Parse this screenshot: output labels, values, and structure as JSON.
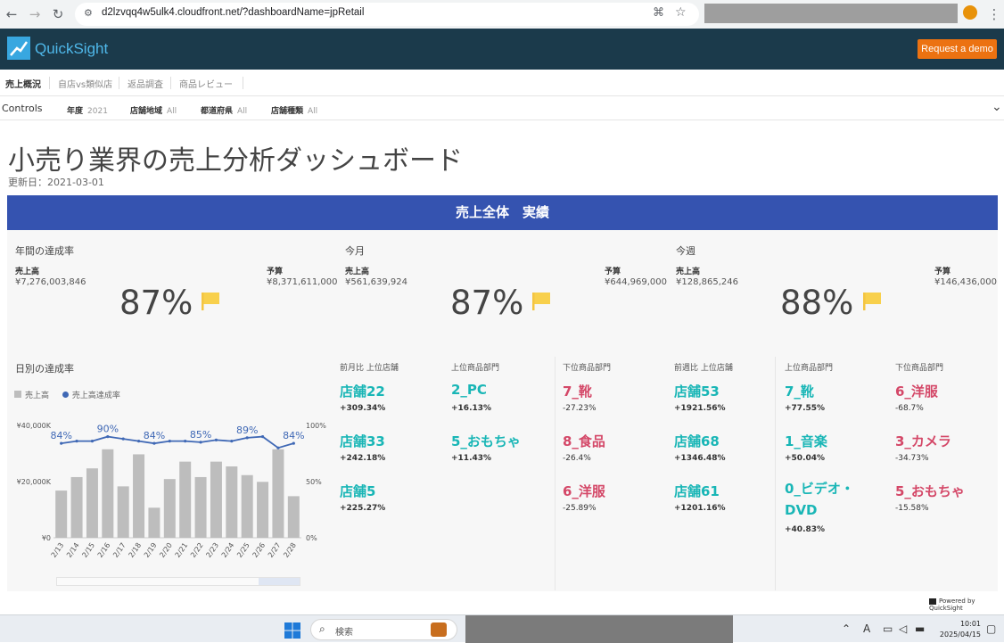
{
  "browser": {
    "url": "d2lzvqq4w5ulk4.cloudfront.net/?dashboardName=jpRetail"
  },
  "app": {
    "logo_text": "QuickSight",
    "demo_button": "Request a demo",
    "brand_color": "#1b3a4b",
    "accent_color": "#ec7211"
  },
  "tabs": [
    "売上概況",
    "自店vs類似店",
    "返品調査",
    "商品レビュー"
  ],
  "controls": {
    "title": "Controls",
    "items": [
      {
        "label": "年度",
        "value": "2021"
      },
      {
        "label": "店舗地域",
        "value": "All"
      },
      {
        "label": "都道府県",
        "value": "All"
      },
      {
        "label": "店舗種類",
        "value": "All"
      }
    ]
  },
  "dashboard": {
    "title": "小売り業界の売上分析ダッシュボード",
    "updated": "更新日：2021-03-01",
    "banner": "売上全体　実績"
  },
  "kpis": [
    {
      "title": "年間の達成率",
      "sales_label": "売上高",
      "sales": "¥7,276,003,846",
      "budget_label": "予算",
      "budget": "¥8,371,611,000",
      "pct": "87%"
    },
    {
      "title": "今月",
      "sales_label": "売上高",
      "sales": "¥561,639,924",
      "budget_label": "予算",
      "budget": "¥644,969,000",
      "pct": "87%"
    },
    {
      "title": "今週",
      "sales_label": "売上高",
      "sales": "¥128,865,246",
      "budget_label": "予算",
      "budget": "¥146,436,000",
      "pct": "88%"
    }
  ],
  "daily": {
    "title": "日別の達成率",
    "legend_sales": "売上高",
    "legend_rate": "売上高達成率"
  },
  "chart_data": {
    "type": "bar",
    "categories": [
      "2/13",
      "2/14",
      "2/15",
      "2/16",
      "2/17",
      "2/18",
      "2/19",
      "2/20",
      "2/21",
      "2/22",
      "2/23",
      "2/24",
      "2/25",
      "2/26",
      "2/27",
      "2/28"
    ],
    "series": [
      {
        "name": "売上高",
        "values": [
          16800,
          21600,
          24700,
          31500,
          18300,
          29700,
          10700,
          20900,
          27100,
          21600,
          27100,
          25400,
          22300,
          19900,
          31500,
          14800
        ],
        "color": "#bdbdbd"
      },
      {
        "name": "売上高達成率",
        "values": [
          84,
          86,
          86,
          90,
          88,
          86,
          84,
          86,
          86,
          85,
          87,
          86,
          89,
          90,
          80,
          84
        ],
        "color": "#3f68b5"
      }
    ],
    "point_labels": [
      {
        "index": 0,
        "text": "84%"
      },
      {
        "index": 3,
        "text": "90%"
      },
      {
        "index": 6,
        "text": "84%"
      },
      {
        "index": 9,
        "text": "85%"
      },
      {
        "index": 12,
        "text": "89%"
      },
      {
        "index": 15,
        "text": "84%"
      }
    ],
    "y_left_ticks": [
      "¥0",
      "¥20,000K",
      "¥40,000K"
    ],
    "y_right_ticks": [
      "0%",
      "50%",
      "100%"
    ],
    "ylim_left": [
      0,
      40000
    ],
    "ylim_right": [
      0,
      100
    ]
  },
  "lists": [
    {
      "header": "前月比 上位店舗",
      "color": "teal",
      "bold_delta": true,
      "items": [
        {
          "name": "店舗22",
          "delta": "+309.34%"
        },
        {
          "name": "店舗33",
          "delta": "+242.18%"
        },
        {
          "name": "店舗5",
          "delta": "+225.27%"
        }
      ]
    },
    {
      "header": "上位商品部門",
      "color": "teal",
      "bold_delta": true,
      "items": [
        {
          "name": "2_PC",
          "delta": "+16.13%"
        },
        {
          "name": "5_おもちゃ",
          "delta": "+11.43%"
        }
      ]
    },
    {
      "header": "下位商品部門",
      "color": "pink",
      "bold_delta": false,
      "items": [
        {
          "name": "7_靴",
          "delta": "-27.23%"
        },
        {
          "name": "8_食品",
          "delta": "-26.4%"
        },
        {
          "name": "6_洋服",
          "delta": "-25.89%"
        }
      ]
    },
    {
      "header": "前週比 上位店舗",
      "color": "teal",
      "bold_delta": true,
      "items": [
        {
          "name": "店舗53",
          "delta": "+1921.56%"
        },
        {
          "name": "店舗68",
          "delta": "+1346.48%"
        },
        {
          "name": "店舗61",
          "delta": "+1201.16%"
        }
      ]
    },
    {
      "header": "上位商品部門",
      "color": "teal",
      "bold_delta": true,
      "items": [
        {
          "name": "7_靴",
          "delta": "+77.55%"
        },
        {
          "name": "1_音楽",
          "delta": "+50.04%"
        },
        {
          "name": "0_ビデオ・DVD",
          "name_line1": "0_ビデオ・",
          "name_line2": "DVD",
          "delta": "+40.83%"
        }
      ]
    },
    {
      "header": "下位商品部門",
      "color": "pink",
      "bold_delta": false,
      "items": [
        {
          "name": "6_洋服",
          "delta": "-68.7%"
        },
        {
          "name": "3_カメラ",
          "delta": "-34.73%"
        },
        {
          "name": "5_おもちゃ",
          "delta": "-15.58%"
        }
      ]
    }
  ],
  "footer": {
    "powered": "Powered by QuickSight"
  },
  "taskbar": {
    "search_placeholder": "検索",
    "time": "10:01",
    "date": "2025/04/15"
  }
}
